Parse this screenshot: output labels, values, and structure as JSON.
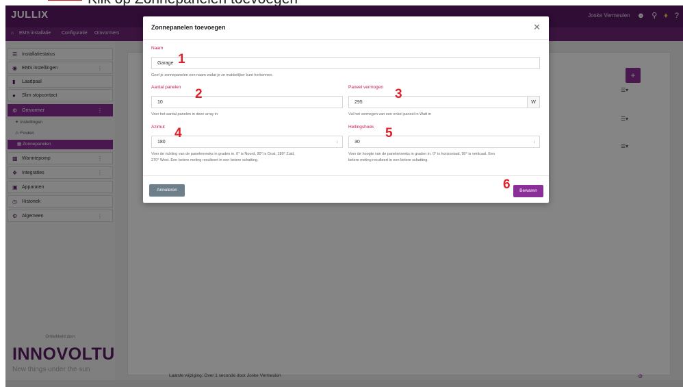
{
  "caption": {
    "text": "Klik op Zonnepanelen toevoegen"
  },
  "topbar": {
    "logo": "JULLIX",
    "user": "Joske Vermeulen",
    "user_icon": "user-icon",
    "search_icon": "search-icon",
    "bell_icon": "bell-icon",
    "help_icon": "help-icon"
  },
  "breadcrumb": [
    "EMS installatie",
    "Configuratie",
    "Omvormers"
  ],
  "sidebar": {
    "items": [
      {
        "label": "Installatiestatus",
        "icon": "status-icon"
      },
      {
        "label": "EMS instellingen",
        "icon": "ems-icon"
      },
      {
        "label": "Laadpaal",
        "icon": "charger-icon"
      },
      {
        "label": "Slim stopcontact",
        "icon": "plug-icon"
      },
      {
        "label": "Omvormer",
        "icon": "gear-icon"
      },
      {
        "label": "Warmtepomp",
        "icon": "heatpump-icon"
      },
      {
        "label": "Integraties",
        "icon": "puzzle-icon"
      },
      {
        "label": "Apparaten",
        "icon": "device-icon"
      },
      {
        "label": "Historiek",
        "icon": "history-icon"
      },
      {
        "label": "Algemeen",
        "icon": "settings-icon"
      }
    ],
    "subitems": [
      {
        "label": "Instellingen"
      },
      {
        "label": "Fouten"
      },
      {
        "label": "Zonnepanelen"
      }
    ],
    "powered_by": "Ontwikkeld door",
    "brand": "INNOVOLTUS",
    "tagline": "New things under the sun"
  },
  "main": {
    "footer": "Laatste wijziging: Over 1 seconde door Joske Vermeulen"
  },
  "modal": {
    "title": "Zonnepanelen toevoegen",
    "name": {
      "label": "Naam",
      "value": "Garage",
      "help": "Geef je zonnepanelen een naam zodat je ze makkelijker kunt herkennen."
    },
    "panels": {
      "label": "Aantal panelen",
      "value": "10",
      "help": "Voer het aantal panelen in deze array in"
    },
    "power": {
      "label": "Paneel vermogen",
      "value": "295",
      "unit": "W",
      "help": "Vul het vermogen van een enkel paneel in Watt in"
    },
    "azimuth": {
      "label": "Azimut",
      "value": "180",
      "help1": "Voer de richting van de panelenreeks in graden in. 0° is Noord, 90° is Oost, 180° Zuid,",
      "help2": "270° West. Een betere meting resulteert in een betere schatting."
    },
    "tilt": {
      "label": "Hellingshoek",
      "value": "30",
      "help1": "Voer de hoogte van de panelenreeks in graden in. 0° is horizontaal, 90° is verticaal. Een",
      "help2": "betere meting resulteert in een betere schatting."
    },
    "cancel": "Annuleren",
    "save": "Bewaren"
  },
  "annotations": [
    "1",
    "2",
    "3",
    "4",
    "5",
    "6"
  ]
}
